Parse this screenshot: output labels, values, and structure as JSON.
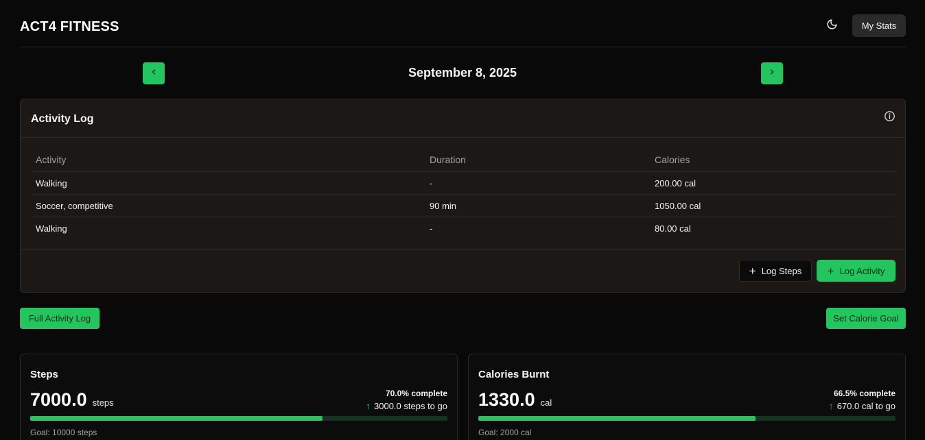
{
  "app": {
    "brand": "ACT4 FITNESS",
    "stats_label": "My Stats",
    "accent": "#22c55e"
  },
  "date_nav": {
    "date": "September 8, 2025",
    "prev_icon": "chevron-left-icon",
    "next_icon": "chevron-right-icon"
  },
  "activity_log": {
    "title": "Activity Log",
    "columns": [
      "Activity",
      "Duration",
      "Calories"
    ],
    "rows": [
      {
        "activity": "Walking",
        "duration": "-",
        "calories": "200.00 cal"
      },
      {
        "activity": "Soccer, competitive",
        "duration": "90 min",
        "calories": "1050.00 cal"
      },
      {
        "activity": "Walking",
        "duration": "-",
        "calories": "80.00 cal"
      }
    ],
    "log_steps_label": "Log Steps",
    "log_activity_label": "Log Activity"
  },
  "actions": {
    "full_log_label": "Full Activity Log",
    "set_goal_label": "Set Calorie Goal"
  },
  "stats": [
    {
      "title": "Steps",
      "value": "7000.0",
      "unit": "steps",
      "percent_text": "70.0% complete",
      "to_go": "3000.0 steps to go",
      "goal": "Goal: 10000 steps",
      "progress": 0.7
    },
    {
      "title": "Calories Burnt",
      "value": "1330.0",
      "unit": "cal",
      "percent_text": "66.5% complete",
      "to_go": "670.0 cal to go",
      "goal": "Goal: 2000 cal",
      "progress": 0.665
    }
  ]
}
